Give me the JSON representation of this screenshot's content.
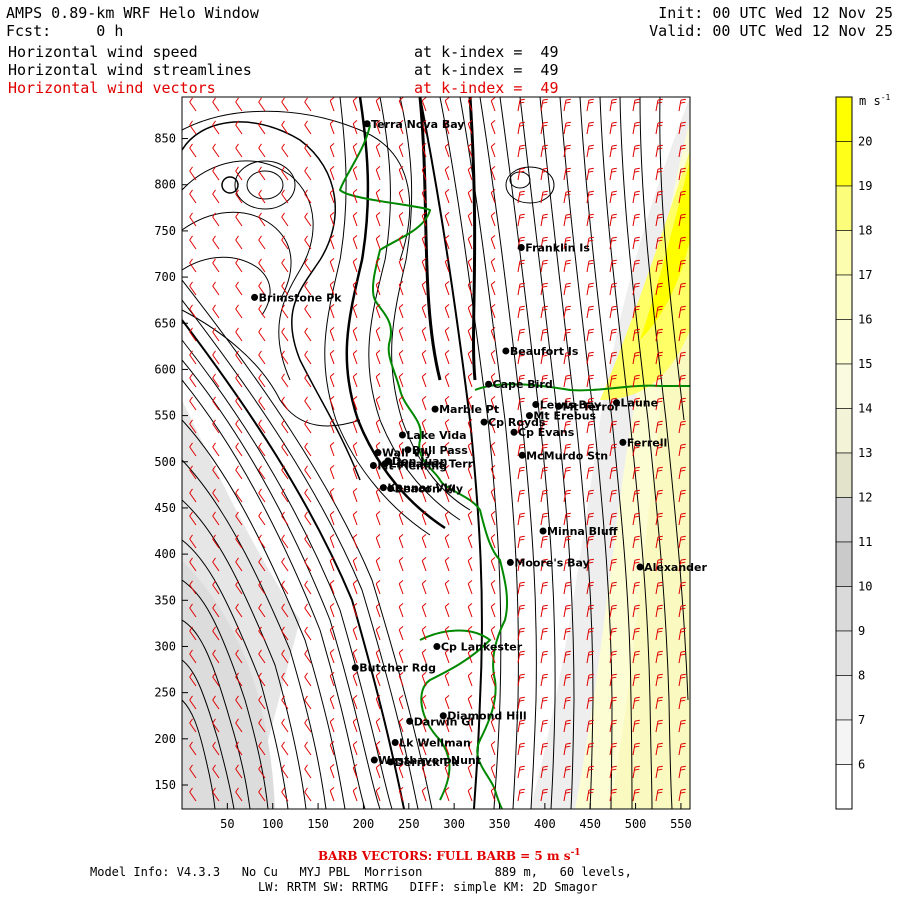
{
  "header": {
    "title": "AMPS 0.89-km WRF Helo Window",
    "fcst": "Fcst:     0 h",
    "init": "Init: 00 UTC Wed 12 Nov 25",
    "valid": "Valid: 00 UTC Wed 12 Nov 25",
    "fields": [
      {
        "name": "Horizontal wind speed",
        "level": "at k-index =  49"
      },
      {
        "name": "Horizontal wind streamlines",
        "level": "at k-index =  49"
      },
      {
        "name": "Horizontal wind vectors",
        "level": "at k-index =  49"
      }
    ]
  },
  "colorbar": {
    "unit": "m s",
    "unit_exp": "-1",
    "levels": [
      "20",
      "19",
      "18",
      "17",
      "16",
      "15",
      "14",
      "13",
      "12",
      "11",
      "10",
      "9",
      "8",
      "7",
      "6"
    ],
    "colors": [
      "#ffff00",
      "#ffff19",
      "#fdfd7c",
      "#fdfdaf",
      "#fcfcc5",
      "#fdfdd4",
      "#fafae0",
      "#f3f3d8",
      "#e3e3cc",
      "#d4d4d4",
      "#cacaca",
      "#dadada",
      "#e2e2e2",
      "#ececec",
      "#f5f5f5",
      "#ffffff"
    ]
  },
  "axes": {
    "x_ticks": [
      "50",
      "100",
      "150",
      "200",
      "250",
      "300",
      "350",
      "400",
      "450",
      "500",
      "550"
    ],
    "y_ticks": [
      "850",
      "800",
      "750",
      "700",
      "650",
      "600",
      "550",
      "500",
      "450",
      "400",
      "350",
      "300",
      "250",
      "200",
      "150"
    ]
  },
  "places": [
    {
      "name": "Terra Nova Bay",
      "x": 204,
      "y": 866
    },
    {
      "name": "Franklin Is",
      "x": 374,
      "y": 732
    },
    {
      "name": "Brimstone Pk",
      "x": 80,
      "y": 678
    },
    {
      "name": "Beaufort Is",
      "x": 357,
      "y": 620
    },
    {
      "name": "Cape Bird",
      "x": 338,
      "y": 584
    },
    {
      "name": "Lewis Bay",
      "x": 390,
      "y": 562
    },
    {
      "name": "Mt Terror",
      "x": 415,
      "y": 560
    },
    {
      "name": "Laune",
      "x": 479,
      "y": 564
    },
    {
      "name": "Marble Pt",
      "x": 279,
      "y": 557
    },
    {
      "name": "Mt Erebus",
      "x": 383,
      "y": 550
    },
    {
      "name": "Cp Royds",
      "x": 333,
      "y": 543
    },
    {
      "name": "Cp Evans",
      "x": 366,
      "y": 532
    },
    {
      "name": "Lake Vida",
      "x": 243,
      "y": 529
    },
    {
      "name": "Ferrell",
      "x": 486,
      "y": 521
    },
    {
      "name": "Wall Vly",
      "x": 216,
      "y": 510
    },
    {
      "name": "Bull Pass",
      "x": 249,
      "y": 513
    },
    {
      "name": "McMurdo Stn",
      "x": 375,
      "y": 507
    },
    {
      "name": "Don Juan",
      "x": 227,
      "y": 501
    },
    {
      "name": "Mt Fleming",
      "x": 211,
      "y": 496
    },
    {
      "name": "Linnaeus Terr",
      "x": 224,
      "y": 498
    },
    {
      "name": "Kennar Vly",
      "x": 222,
      "y": 472
    },
    {
      "name": "Beacon Vly",
      "x": 230,
      "y": 471
    },
    {
      "name": "Minna Bluff",
      "x": 398,
      "y": 425
    },
    {
      "name": "Moore's Bay",
      "x": 362,
      "y": 391
    },
    {
      "name": "Alexander",
      "x": 505,
      "y": 386
    },
    {
      "name": "Cp Lankester",
      "x": 281,
      "y": 300
    },
    {
      "name": "Butcher Rdg",
      "x": 191,
      "y": 277
    },
    {
      "name": "Darwin Gl",
      "x": 251,
      "y": 219
    },
    {
      "name": "Diamond Hill",
      "x": 288,
      "y": 225
    },
    {
      "name": "Lk Wellman",
      "x": 235,
      "y": 196
    },
    {
      "name": "Westhaven Nunt",
      "x": 212,
      "y": 177
    },
    {
      "name": "Derrick Pk",
      "x": 230,
      "y": 175
    }
  ],
  "footer": {
    "barb_note": "BARB VECTORS: FULL BARB = 5 m s",
    "barb_exp": "-1",
    "model_line": "Model Info: V4.3.3   No Cu   MYJ PBL  Morrison          889 m,   60 levels,",
    "phys_line": "LW: RRTM SW: RRTMG   DIFF: simple KM: 2D Smagor"
  },
  "colors": {
    "coast": "#008800",
    "barb": "#e00000",
    "markers": "#000000"
  }
}
